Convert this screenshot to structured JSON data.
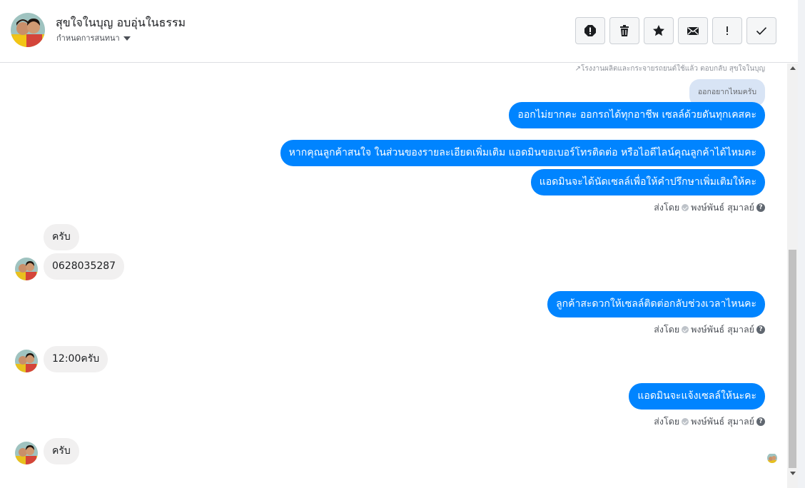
{
  "header": {
    "contact_name": "สุขใจในบุญ อบอุ่นในธรรม",
    "subtitle": "กำหนดการสนทนา",
    "tools": [
      {
        "name": "report-icon"
      },
      {
        "name": "trash-icon"
      },
      {
        "name": "star-icon"
      },
      {
        "name": "envelope-icon"
      },
      {
        "name": "exclamation-icon"
      },
      {
        "name": "checkmark-icon"
      }
    ]
  },
  "chat": {
    "reply_note": "↗โรงงานผลิตและกระจายรถยนต์ใช้แล้ว ตอบกลับ สุขใจในบุญ",
    "quote_text": "ออกอยากไหมครับ",
    "messages_out": [
      "ออกไม่ยากคะ ออกรถได้ทุกอาชีพ เซลล์ด้วยดันทุกเคสคะ",
      "หากคุณลูกค้าสนใจ ในส่วนของรายละเอียดเพิ่มเติม แอดมินขอเบอร์โทรติดต่อ หรือไอดีไลน์คุณลูกค้าได้ไหมคะ",
      "แอดมินจะได้นัดเซลล์เพื่อให้คำปรึกษาเพิ่มเติมให้คะ",
      "ลูกค้าสะดวกให้เซลล์ติดต่อกลับช่วงเวลาไหนคะ",
      "แอดมินจะแจ้งเซลล์ให้นะคะ"
    ],
    "messages_in": [
      "ครับ",
      "0628035287",
      "12:00ครับ",
      "ครับ"
    ],
    "sent_by_prefix": "ส่งโดย",
    "sent_by_name": "พงษ์พันธ์ สุมาลย์",
    "help_mark": "?"
  },
  "colors": {
    "outgoing_bubble": "#0084ff",
    "incoming_bubble": "#f1f0f0",
    "quote_bg": "#d8e4f5"
  }
}
